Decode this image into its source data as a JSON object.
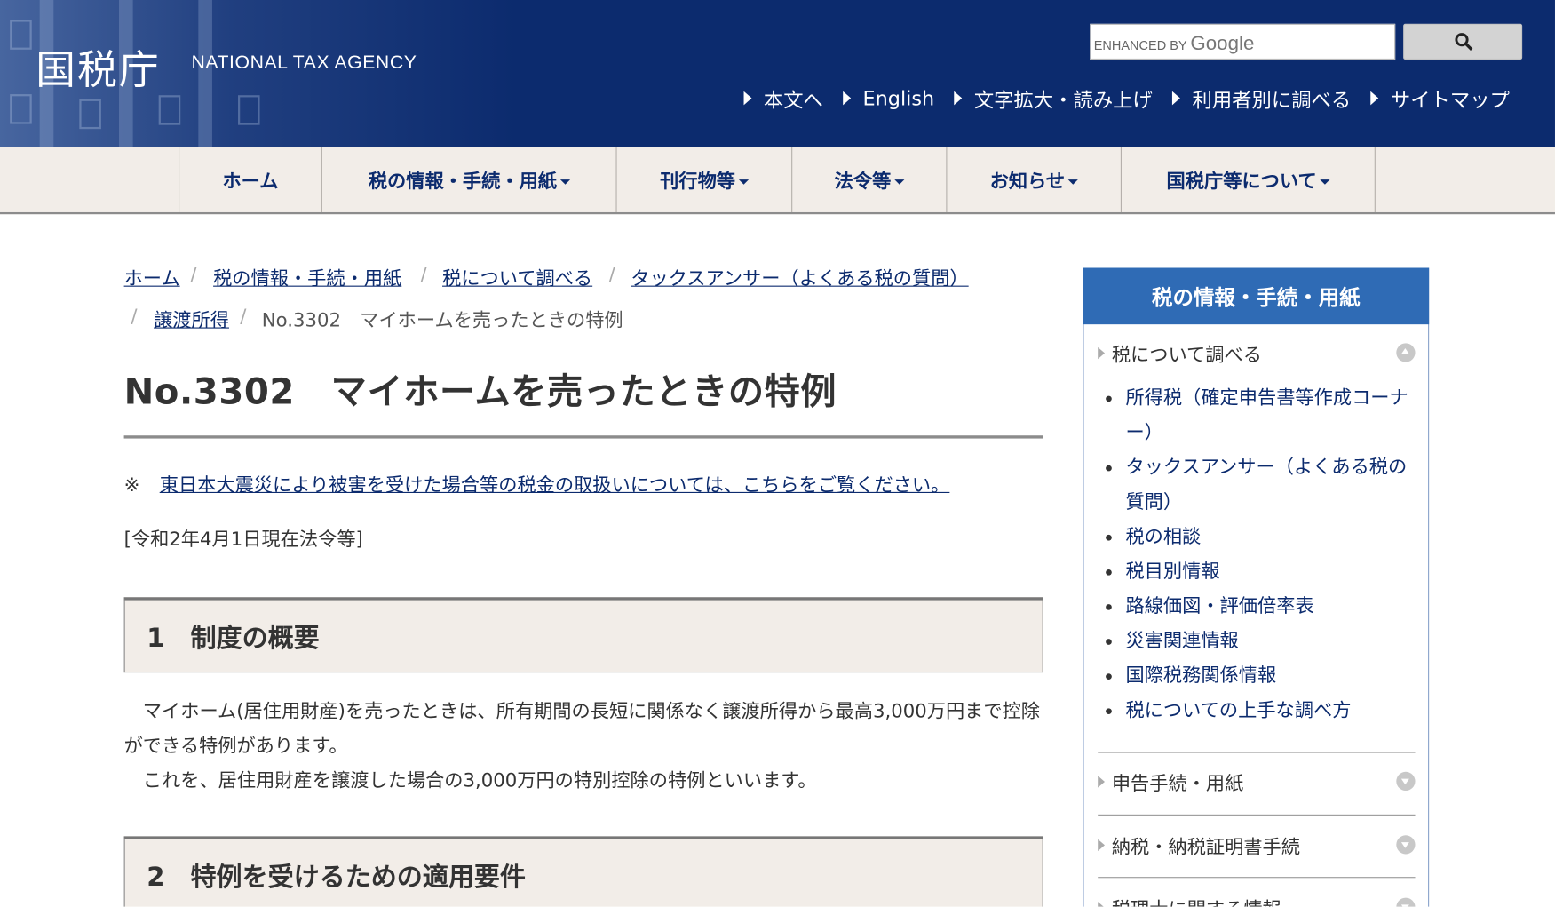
{
  "header": {
    "logo_jp": "国税庁",
    "logo_en": "NATIONAL TAX AGENCY",
    "search": {
      "brand_prefix": "ENHANCED BY",
      "brand_name": "Google",
      "placeholder": "",
      "button_icon": "search-icon"
    },
    "util_links": [
      "本文へ",
      "English",
      "文字拡大・読み上げ",
      "利用者別に調べる",
      "サイトマップ"
    ]
  },
  "gnav": {
    "items": [
      "ホーム",
      "税の情報・手続・用紙",
      "刊行物等",
      "法令等",
      "お知らせ",
      "国税庁等について"
    ]
  },
  "breadcrumb": {
    "links": [
      "ホーム",
      "税の情報・手続・用紙",
      "税について調べる",
      "タックスアンサー（よくある税の質問）",
      "譲渡所得"
    ],
    "separator": "/",
    "current": "No.3302　マイホームを売ったときの特例"
  },
  "main": {
    "title": "No.3302　マイホームを売ったときの特例",
    "note_mark": "※",
    "note_link": "東日本大震災により被害を受けた場合等の税金の取扱いについては、こちらをご覧ください。",
    "as_of": "[令和2年4月1日現在法令等]",
    "sections": [
      {
        "label": "1　制度の概要"
      },
      {
        "label": "2　特例を受けるための適用要件"
      }
    ],
    "paragraphs": [
      "　マイホーム(居住用財産)を売ったときは、所有期間の長短に関係なく譲渡所得から最高3,000万円まで控除ができる特例があります。",
      "　これを、居住用財産を譲渡した場合の3,000万円の特別控除の特例といいます。"
    ]
  },
  "sidebar": {
    "title": "税の情報・手続・用紙",
    "categories": [
      "税について調べる",
      "申告手続・用紙",
      "納税・納税証明書手続",
      "税理士に関する情報"
    ],
    "items": [
      "所得税（確定申告書等作成コーナー）",
      "タックスアンサー（よくある税の質問）",
      "税の相談",
      "税目別情報",
      "路線価図・評価倍率表",
      "災害関連情報",
      "国際税務関係情報",
      "税についての上手な調べ方"
    ]
  },
  "colors": {
    "header_bg": "#0c2b6e",
    "nav_bg": "#f2ede8",
    "link": "#0c2b6e",
    "sidebar_head": "#2f6bb5"
  }
}
